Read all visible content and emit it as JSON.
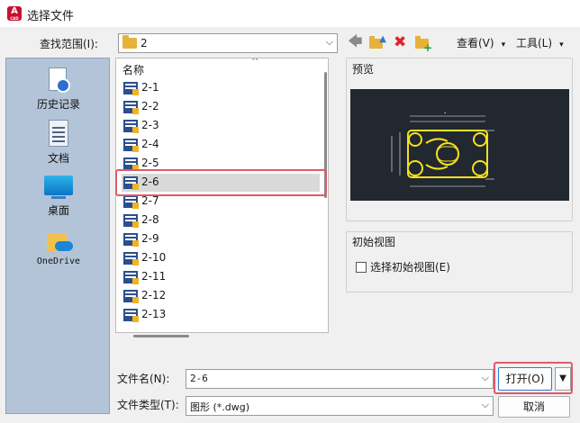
{
  "window": {
    "title": "选择文件",
    "app_icon_letter": "A",
    "app_icon_sub": "CAD"
  },
  "lookin": {
    "label": "查找范围(I):",
    "value": "2"
  },
  "toolbar": {
    "views": "查看(V)",
    "tools": "工具(L)"
  },
  "places": [
    {
      "label": "历史记录",
      "icon": "history-icon"
    },
    {
      "label": "文档",
      "icon": "documents-icon"
    },
    {
      "label": "桌面",
      "icon": "desktop-icon"
    },
    {
      "label": "OneDrive",
      "icon": "onedrive-icon"
    }
  ],
  "filelist": {
    "header": "名称",
    "items": [
      "2-1",
      "2-2",
      "2-3",
      "2-4",
      "2-5",
      "2-6",
      "2-7",
      "2-8",
      "2-9",
      "2-10",
      "2-11",
      "2-12",
      "2-13"
    ],
    "selected": "2-6"
  },
  "preview": {
    "title": "预览"
  },
  "initial_view": {
    "title": "初始视图",
    "checkbox_label": "选择初始视图(E)",
    "checked": false
  },
  "filename": {
    "label": "文件名(N):",
    "value": "2-6"
  },
  "filetype": {
    "label": "文件类型(T):",
    "value": "图形 (*.dwg)"
  },
  "buttons": {
    "open": "打开(O)",
    "cancel": "取消"
  },
  "colors": {
    "selection": "#d9d9d9",
    "highlight": "#e05a6a",
    "places_bg": "#b4c4d8",
    "preview_bg": "#212830"
  }
}
